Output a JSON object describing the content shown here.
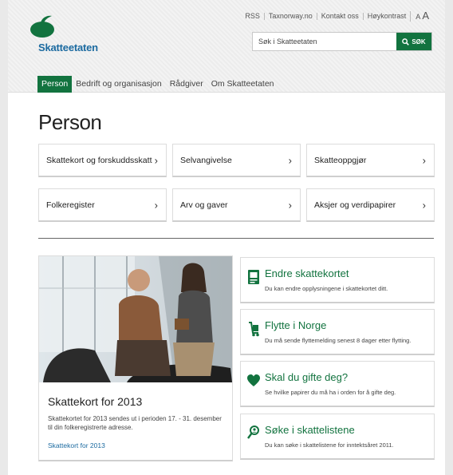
{
  "header": {
    "logo_text": "Skatteetaten",
    "top_links": [
      "RSS",
      "Taxnorway.no",
      "Kontakt oss",
      "Høykontrast"
    ],
    "text_size_small": "A",
    "text_size_large": "A",
    "search_placeholder": "Søk i Skatteetaten",
    "search_button": "SØK"
  },
  "nav": {
    "items": [
      "Person",
      "Bedrift og organisasjon",
      "Rådgiver",
      "Om Skatteetaten"
    ],
    "active": "Person"
  },
  "page_title": "Person",
  "tiles": [
    "Skattekort og forskuddsskatt",
    "Selvangivelse",
    "Skatteoppgjør",
    "Folkeregister",
    "Arv og gaver",
    "Aksjer og verdipapirer"
  ],
  "feature": {
    "title": "Skattekort for 2013",
    "text": "Skattekortet for 2013 sendes ut i perioden 17. - 31. desember til din folkeregistrerte adresse.",
    "link": "Skattekort for 2013"
  },
  "cards": [
    {
      "icon": "tax-card-icon",
      "title": "Endre skattekortet",
      "text": "Du kan endre opplysningene i skattekortet ditt."
    },
    {
      "icon": "moving-trolley-icon",
      "title": "Flytte i Norge",
      "text": "Du må sende flyttemelding senest 8 dager etter flytting."
    },
    {
      "icon": "heart-icon",
      "title": "Skal du gifte deg?",
      "text": "Se hvilke papirer du må ha i orden for å gifte deg."
    },
    {
      "icon": "search-person-icon",
      "title": "Søke i skattelistene",
      "text": "Du kan søke i skattelistene for inntektsåret 2011."
    }
  ],
  "colors": {
    "brand_green": "#12733f",
    "brand_blue": "#1b6aa0"
  }
}
